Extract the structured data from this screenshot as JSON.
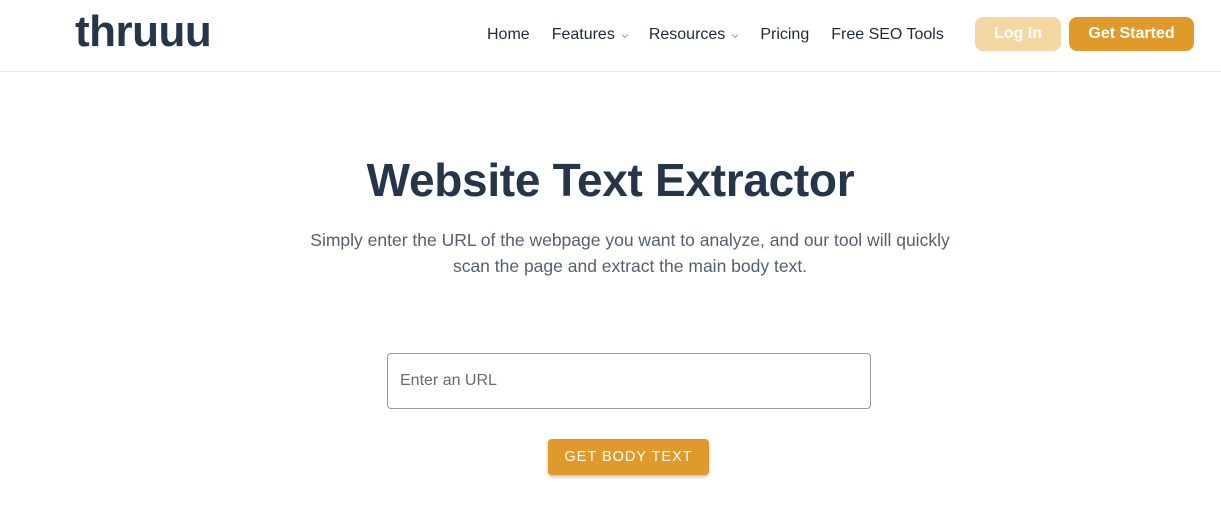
{
  "brand": {
    "logo_text": "thruuu"
  },
  "nav": {
    "items": [
      {
        "label": "Home"
      },
      {
        "label": "Features"
      },
      {
        "label": "Resources"
      },
      {
        "label": "Pricing"
      },
      {
        "label": "Free SEO Tools"
      }
    ],
    "login_label": "Log In",
    "get_started_label": "Get Started"
  },
  "hero": {
    "title": "Website Text Extractor",
    "subtitle": "Simply enter the URL of the webpage you want to analyze, and our tool will quickly scan the page and extract the main body text."
  },
  "form": {
    "url_placeholder": "Enter an URL",
    "url_value": "",
    "submit_label": "GET BODY TEXT"
  },
  "icons": {
    "dropdown": "chevron-down-icon"
  },
  "colors": {
    "accent": "#e09a2c",
    "accent_light": "#f5d7a3",
    "heading": "#25354a",
    "body_text": "#55606e"
  }
}
